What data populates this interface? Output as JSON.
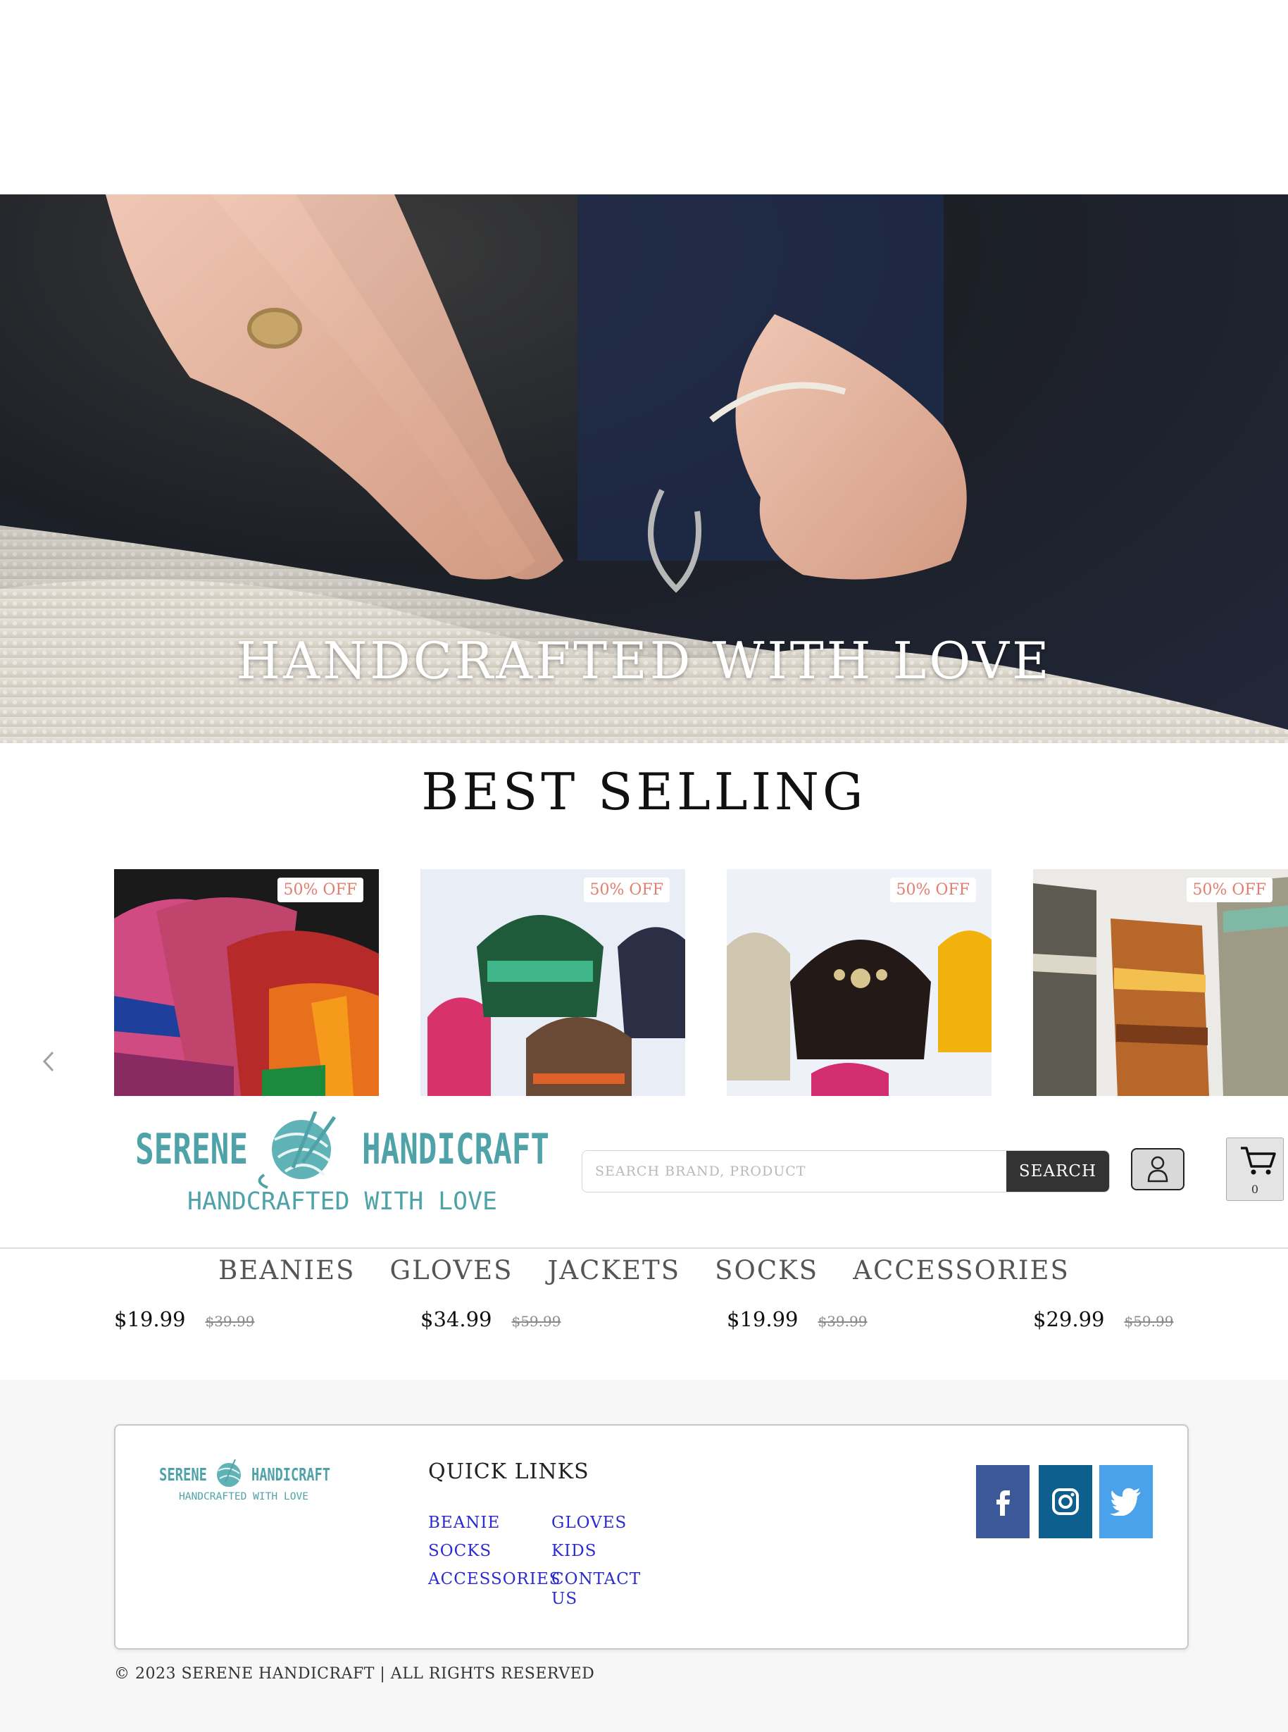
{
  "hero": {
    "title": "HANDCRAFTED WITH LOVE"
  },
  "best_selling": {
    "title": "BEST SELLING",
    "products": [
      {
        "badge": "50% OFF",
        "price": "$19.99",
        "old_price": "$39.99"
      },
      {
        "badge": "50% OFF",
        "price": "$34.99",
        "old_price": "$59.99"
      },
      {
        "badge": "50% OFF",
        "price": "$19.99",
        "old_price": "$39.99"
      },
      {
        "badge": "50% OFF",
        "price": "$29.99",
        "old_price": "$59.99"
      }
    ],
    "prev_icon": "chevron-left-icon"
  },
  "header": {
    "logo": {
      "name_left": "SERENE",
      "name_right": "HANDICRAFT",
      "tagline": "HANDCRAFTED WITH LOVE"
    },
    "search": {
      "placeholder": "SEARCH BRAND, PRODUCT",
      "button_label": "SEARCH"
    },
    "user_icon": "user-icon",
    "cart": {
      "icon": "cart-icon",
      "count": "0"
    }
  },
  "nav": {
    "items": [
      "BEANIES",
      "GLOVES",
      "JACKETS",
      "SOCKS",
      "ACCESSORIES"
    ]
  },
  "footer": {
    "quick_links_title": "QUICK LINKS",
    "links": [
      "BEANIE",
      "GLOVES",
      "SOCKS",
      "KIDS",
      "ACCESSORIES",
      "CONTACT US"
    ],
    "social": [
      {
        "icon": "facebook-icon",
        "color": "#3b5998"
      },
      {
        "icon": "instagram-icon",
        "color": "#0d5f8e"
      },
      {
        "icon": "twitter-icon",
        "color": "#4aa3ea"
      }
    ],
    "copyright": "© 2023 SERENE HANDICRAFT | ALL RIGHTS RESERVED"
  },
  "colors": {
    "accent": "#4fa3a8",
    "badge_text": "#e07f70",
    "link": "#2b2bd0",
    "search_button": "#333333"
  }
}
